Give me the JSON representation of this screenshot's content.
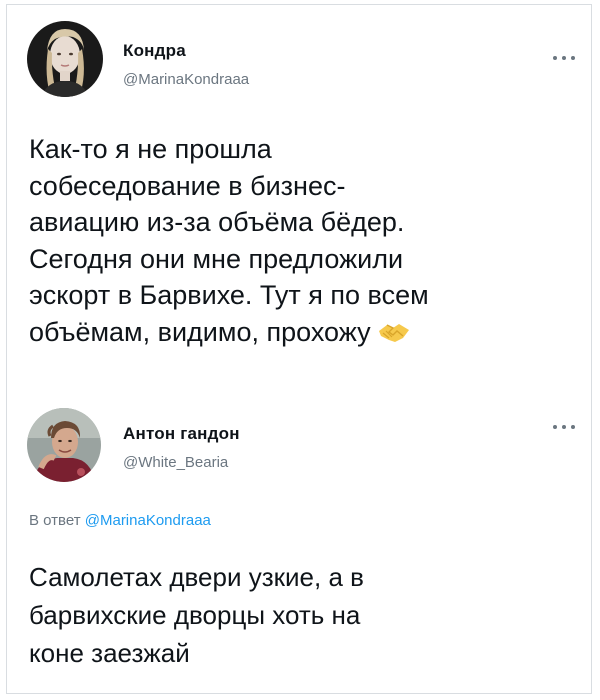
{
  "tweets": [
    {
      "author": {
        "display_name": "Кондра",
        "handle": "@MarinaKondraaa"
      },
      "text_lines": [
        "Как-то я не прошла",
        "собеседование в бизнес-",
        "авиацию из-за объёма бёдер.",
        "Сегодня они мне предложили",
        "эскорт в Барвихе. Тут я по всем",
        "объёмам, видимо, прохожу"
      ],
      "emoji": "handshake-icon"
    },
    {
      "author": {
        "display_name": "Антон гандон",
        "handle": "@White_Bearia"
      },
      "reply_to": {
        "prefix": "В ответ",
        "mention": "@MarinaKondraaa"
      },
      "text_lines": [
        "Самолетах двери узкие, а в",
        "барвихские дворцы хоть на",
        "коне заезжай"
      ]
    }
  ],
  "colors": {
    "text": "#0f1419",
    "secondary": "#6b7680",
    "link": "#1d9bf0",
    "border": "#d9dde1"
  }
}
